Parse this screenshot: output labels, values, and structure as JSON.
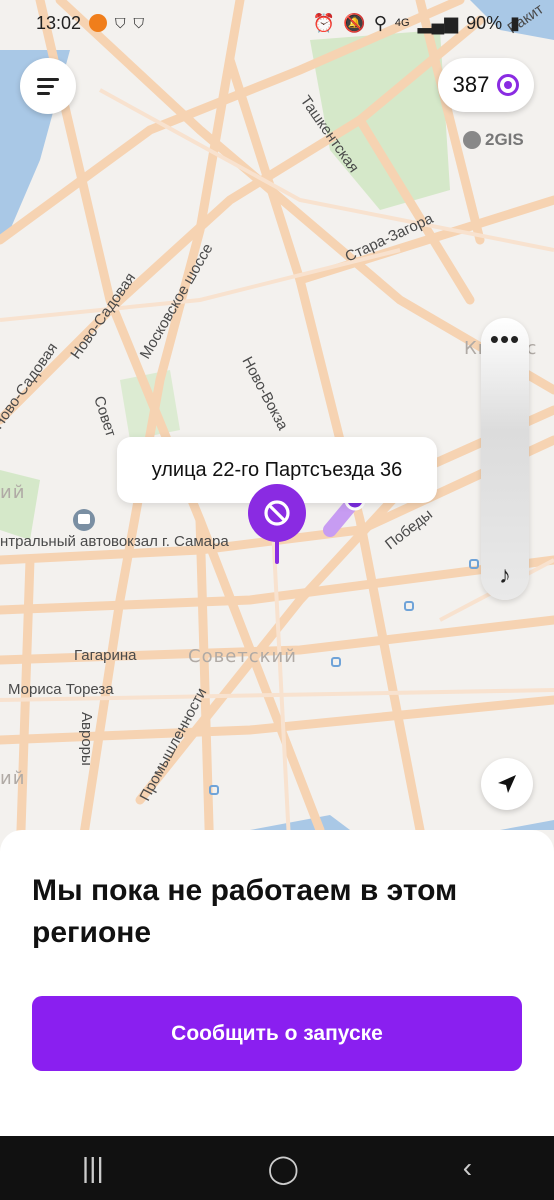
{
  "status": {
    "time": "13:02",
    "net": "4G",
    "battery": "90%"
  },
  "balance": {
    "amount": "387"
  },
  "map": {
    "provider": "2GIS",
    "streets": [
      "Ташкентская",
      "Стара-Загора",
      "Московское шоссе",
      "Ново-Садовая",
      "Ново-Садовая",
      "Ново-Вокза",
      "Совет",
      "Победы",
      "Гагарина",
      "Мориса Тореза",
      "Авроры",
      "Промышленности",
      "Ракит"
    ],
    "districts": [
      "Советский",
      "Кировс",
      "ий",
      "ий"
    ],
    "poi": "нтральный автовокзал г. Самара",
    "callout": "улица 22-го Партсъезда 36"
  },
  "sheet": {
    "title": "Мы пока не работаем в этом регионе",
    "cta": "Сообщить о запуске"
  },
  "colors": {
    "accent": "#8a1ff0",
    "road": "#f6d3b2",
    "water": "#a9c8e6",
    "park": "#cfe5c4"
  },
  "icons": {
    "menu": "menu-icon",
    "coin": "coin-icon",
    "more": "more-icon",
    "music": "music-note-icon",
    "location": "location-arrow-icon",
    "blocked": "blocked-icon"
  }
}
